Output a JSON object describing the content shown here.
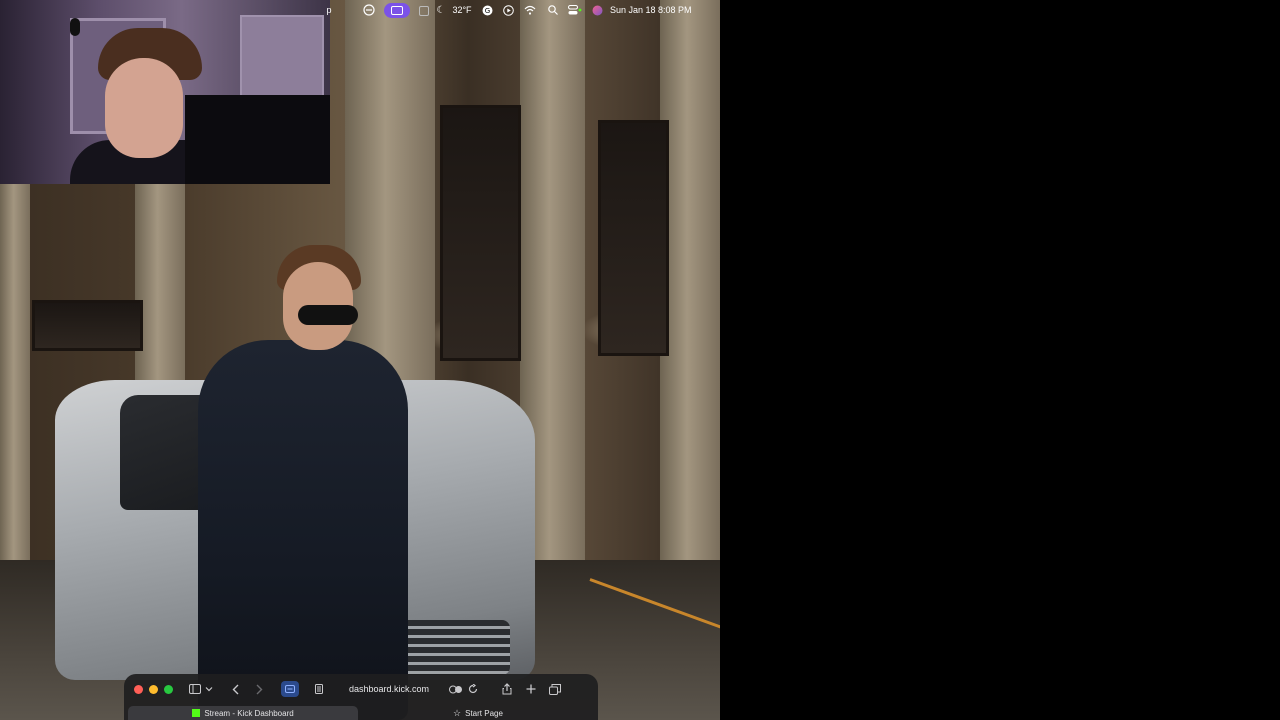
{
  "menubar": {
    "app_letter": "p",
    "weather": "32°F",
    "datetime": "Sun Jan 18  8:08 PM",
    "icons": [
      "hourglass-icon",
      "screen-record-icon",
      "clipboard-icon",
      "moon-icon",
      "grammarly-icon",
      "play-icon",
      "wifi-icon",
      "search-icon",
      "control-center-icon",
      "siri-icon"
    ]
  },
  "browser": {
    "url": "dashboard.kick.com",
    "tabs": [
      {
        "label": "Stream - Kick Dashboard",
        "active": true,
        "icon": "kick-logo"
      },
      {
        "label": "Start Page",
        "active": false,
        "icon": "star-icon"
      }
    ]
  },
  "colors": {
    "record_pill": "#7b52e8",
    "kick_green": "#53fc18",
    "traffic_red": "#ff5f57",
    "traffic_yellow": "#febc2e",
    "traffic_green": "#28c840"
  }
}
